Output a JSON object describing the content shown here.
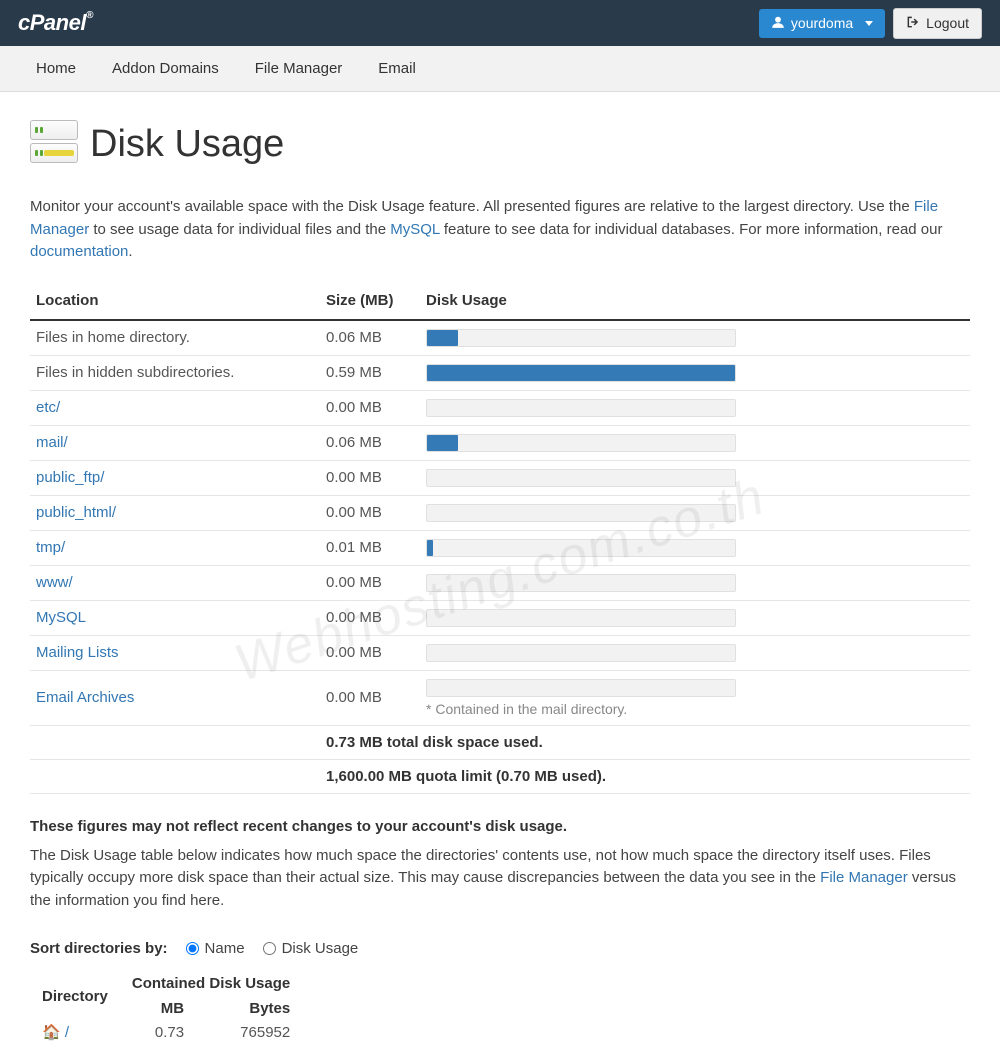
{
  "brand": "cPanel",
  "user_menu": {
    "username": "yourdoma",
    "logout": "Logout"
  },
  "nav": [
    "Home",
    "Addon Domains",
    "File Manager",
    "Email"
  ],
  "page": {
    "title": "Disk Usage",
    "intro_pre": "Monitor your account's available space with the Disk Usage feature. All presented figures are relative to the largest directory. Use the ",
    "link_fm": "File Manager",
    "intro_mid": " to see usage data for individual files and the ",
    "link_mysql": "MySQL",
    "intro_post": " feature to see data for individual databases. For more information, read our ",
    "link_doc": "documentation",
    "intro_end": "."
  },
  "table": {
    "headers": {
      "location": "Location",
      "size": "Size (MB)",
      "usage": "Disk Usage"
    },
    "rows": [
      {
        "label": "Files in home directory.",
        "link": false,
        "size": "0.06 MB",
        "pct": 10
      },
      {
        "label": "Files in hidden subdirectories.",
        "link": false,
        "size": "0.59 MB",
        "pct": 100
      },
      {
        "label": "etc/",
        "link": true,
        "size": "0.00 MB",
        "pct": 0
      },
      {
        "label": "mail/",
        "link": true,
        "size": "0.06 MB",
        "pct": 10
      },
      {
        "label": "public_ftp/",
        "link": true,
        "size": "0.00 MB",
        "pct": 0
      },
      {
        "label": "public_html/",
        "link": true,
        "size": "0.00 MB",
        "pct": 0
      },
      {
        "label": "tmp/",
        "link": true,
        "size": "0.01 MB",
        "pct": 2
      },
      {
        "label": "www/",
        "link": true,
        "size": "0.00 MB",
        "pct": 0
      },
      {
        "label": "MySQL",
        "link": true,
        "size": "0.00 MB",
        "pct": 0
      },
      {
        "label": "Mailing Lists",
        "link": true,
        "size": "0.00 MB",
        "pct": 0
      },
      {
        "label": "Email Archives",
        "link": true,
        "size": "0.00 MB",
        "pct": 0,
        "note": "* Contained in the mail directory."
      }
    ],
    "totals": {
      "total_used": "0.73 MB total disk space used.",
      "quota": "1,600.00 MB quota limit (0.70 MB used)."
    }
  },
  "section2": {
    "heading": "These figures may not reflect recent changes to your account's disk usage.",
    "desc_pre": "The Disk Usage table below indicates how much space the directories' contents use, not how much space the directory itself uses. Files typically occupy more disk space than their actual size. This may cause discrepancies between the data you see in the ",
    "link_fm": "File Manager",
    "desc_post": " versus the information you find here."
  },
  "sort": {
    "label": "Sort directories by:",
    "options": {
      "name": "Name",
      "usage": "Disk Usage"
    },
    "selected": "name"
  },
  "dirs_table": {
    "h_dir": "Directory",
    "h_contained": "Contained Disk Usage",
    "h_mb": "MB",
    "h_bytes": "Bytes",
    "rows": [
      {
        "dir_icon": "home",
        "dir": "/",
        "mb": "0.73",
        "bytes": "765952"
      }
    ]
  },
  "watermark": "Webhosting.com.co.th",
  "chart_data": {
    "type": "bar",
    "title": "Disk Usage",
    "xlabel": "Size (MB)",
    "ylabel": "Location",
    "categories": [
      "Files in home directory.",
      "Files in hidden subdirectories.",
      "etc/",
      "mail/",
      "public_ftp/",
      "public_html/",
      "tmp/",
      "www/",
      "MySQL",
      "Mailing Lists",
      "Email Archives"
    ],
    "values": [
      0.06,
      0.59,
      0.0,
      0.06,
      0.0,
      0.0,
      0.01,
      0.0,
      0.0,
      0.0,
      0.0
    ],
    "xlim": [
      0,
      0.59
    ]
  }
}
